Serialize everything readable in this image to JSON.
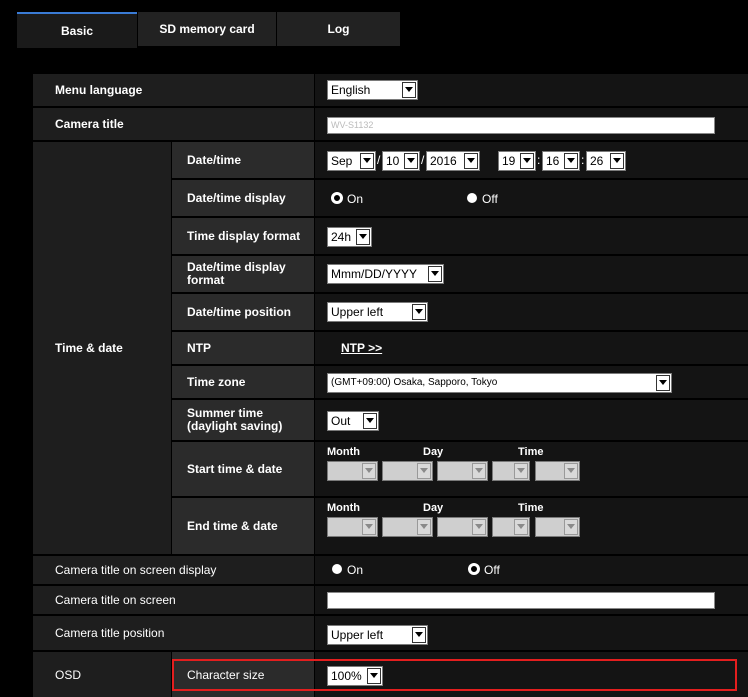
{
  "tabs": [
    {
      "label": "Basic"
    },
    {
      "label": "SD memory card"
    },
    {
      "label": "Log"
    }
  ],
  "rows": {
    "menu_language": {
      "label": "Menu language",
      "value": "English"
    },
    "camera_title": {
      "label": "Camera title",
      "value": "WV-S1132"
    },
    "time_date": {
      "label": "Time & date"
    },
    "datetime": {
      "label": "Date/time",
      "month": "Sep",
      "day": "10",
      "year": "2016",
      "hour": "19",
      "minute": "16",
      "second": "26"
    },
    "datetime_display": {
      "label": "Date/time display",
      "on": "On",
      "off": "Off",
      "selected": "On"
    },
    "time_display_format": {
      "label": "Time display format",
      "value": "24h"
    },
    "datetime_display_format": {
      "label_line1": "Date/time display",
      "label_line2": "format",
      "value": "Mmm/DD/YYYY"
    },
    "datetime_position": {
      "label": "Date/time position",
      "value": "Upper left"
    },
    "ntp": {
      "label": "NTP",
      "link": "NTP >>"
    },
    "time_zone": {
      "label": "Time zone",
      "value": "(GMT+09:00) Osaka, Sapporo, Tokyo"
    },
    "summer_time": {
      "label_line1": "Summer time",
      "label_line2": "(daylight saving)",
      "value": "Out"
    },
    "start_time_date": {
      "label": "Start time & date",
      "month": "Month",
      "day": "Day",
      "time": "Time"
    },
    "end_time_date": {
      "label": "End time & date",
      "month": "Month",
      "day": "Day",
      "time": "Time"
    },
    "camera_title_osd": {
      "label": "Camera title on screen display",
      "on": "On",
      "off": "Off",
      "selected": "Off"
    },
    "camera_title_on_screen": {
      "label": "Camera title on screen",
      "value": ""
    },
    "camera_title_position": {
      "label": "Camera title position",
      "value": "Upper left"
    },
    "osd": {
      "label": "OSD"
    },
    "character_size": {
      "label": "Character size",
      "value": "100%"
    }
  },
  "colors": {
    "highlight": "#e41e1e",
    "active_tab_accent": "#3a7bd5"
  }
}
